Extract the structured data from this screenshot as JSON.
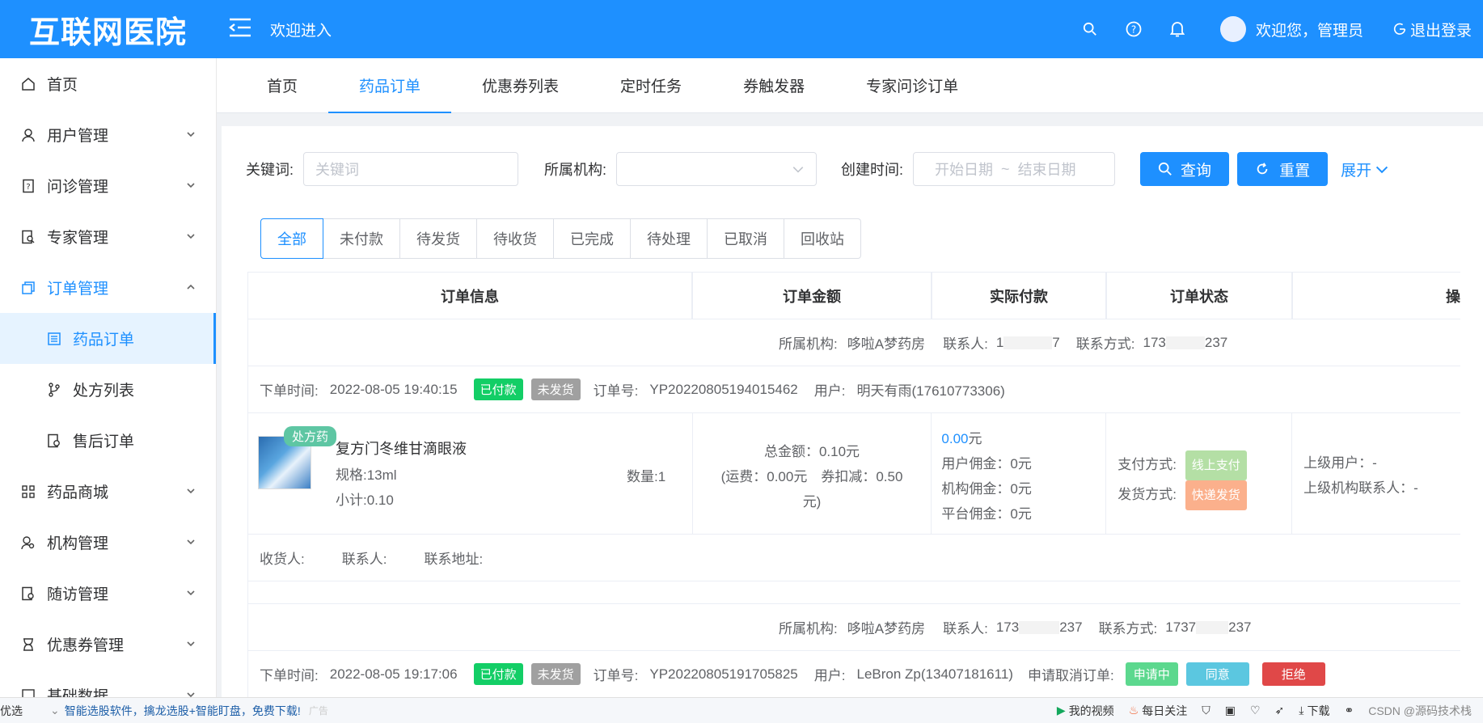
{
  "header": {
    "logo": "互联网医院",
    "welcome": "欢迎进入",
    "greeting": "欢迎您，管理员",
    "logout": "退出登录"
  },
  "sidebar": {
    "items": [
      {
        "label": "首页"
      },
      {
        "label": "用户管理"
      },
      {
        "label": "问诊管理"
      },
      {
        "label": "专家管理"
      },
      {
        "label": "订单管理"
      },
      {
        "label": "药品订单"
      },
      {
        "label": "处方列表"
      },
      {
        "label": "售后订单"
      },
      {
        "label": "药品商城"
      },
      {
        "label": "机构管理"
      },
      {
        "label": "随访管理"
      },
      {
        "label": "优惠券管理"
      },
      {
        "label": "基础数据"
      }
    ]
  },
  "tabs": [
    "首页",
    "药品订单",
    "优惠券列表",
    "定时任务",
    "券触发器",
    "专家问诊订单"
  ],
  "filter": {
    "keyword_label": "关键词:",
    "keyword_placeholder": "关键词",
    "org_label": "所属机构:",
    "time_label": "创建时间:",
    "start_placeholder": "开始日期",
    "tilde": "~",
    "end_placeholder": "结束日期",
    "search_btn": "查询",
    "reset_btn": "重置",
    "expand": "展开"
  },
  "status_tabs": [
    "全部",
    "未付款",
    "待发货",
    "待收货",
    "已完成",
    "待处理",
    "已取消",
    "回收站"
  ],
  "table": {
    "headers": [
      "订单信息",
      "订单金额",
      "实际付款",
      "订单状态",
      "操"
    ],
    "order1": {
      "org_label": "所属机构:",
      "org": "哆啦A梦药房",
      "contact_label": "联系人:",
      "contact_pre": "1",
      "contact_post": "7",
      "phone_label": "联系方式:",
      "phone_pre": "173",
      "phone_post": "237",
      "time_label": "下单时间:",
      "time": "2022-08-05 19:40:15",
      "paid": "已付款",
      "unshipped": "未发货",
      "no_label": "订单号:",
      "no": "YP20220805194015462",
      "user_label": "用户:",
      "user": "明天有雨(17610773306)",
      "rx_badge": "处方药",
      "product": "复方门冬维甘滴眼液",
      "spec": "规格:13ml",
      "subtotal": "小计:0.10",
      "qty": "数量:1",
      "total": "总金额：0.10元",
      "freight": "(运费：0.00元　券扣减：0.50",
      "freight2": "元)",
      "actual": "0.00",
      "yuan": "元",
      "user_comm": "用户佣金：0元",
      "org_comm": "机构佣金：0元",
      "plat_comm": "平台佣金：0元",
      "pay_label": "支付方式:",
      "pay": "线上支付",
      "ship_label": "发货方式:",
      "ship": "快递发货",
      "up_user": "上级用户：-",
      "up_org": "上级机构联系人：-",
      "recv_label": "收货人:",
      "recv_contact_label": "联系人:",
      "recv_addr_label": "联系地址:"
    },
    "order2": {
      "org_label": "所属机构:",
      "org": "哆啦A梦药房",
      "contact_label": "联系人:",
      "contact_pre": "173",
      "contact_post": "237",
      "phone_label": "联系方式:",
      "phone_pre": "1737",
      "phone_post": "237",
      "time_label": "下单时间:",
      "time": "2022-08-05 19:17:06",
      "paid": "已付款",
      "unshipped": "未发货",
      "no_label": "订单号:",
      "no": "YP20220805191705825",
      "user_label": "用户:",
      "user": "LeBron Zp(13407181611)",
      "cancel_label": "申请取消订单:",
      "applying": "申请中",
      "agree": "同意",
      "reject": "拒绝"
    }
  },
  "bottombar": {
    "left": "优选",
    "ad": "智能选股软件，擒龙选股+智能盯盘，免费下载!",
    "ad_tag": "广告",
    "video": "我的视频",
    "daily": "每日关注",
    "download": "下载",
    "watermark": "CSDN @源码技术栈"
  }
}
